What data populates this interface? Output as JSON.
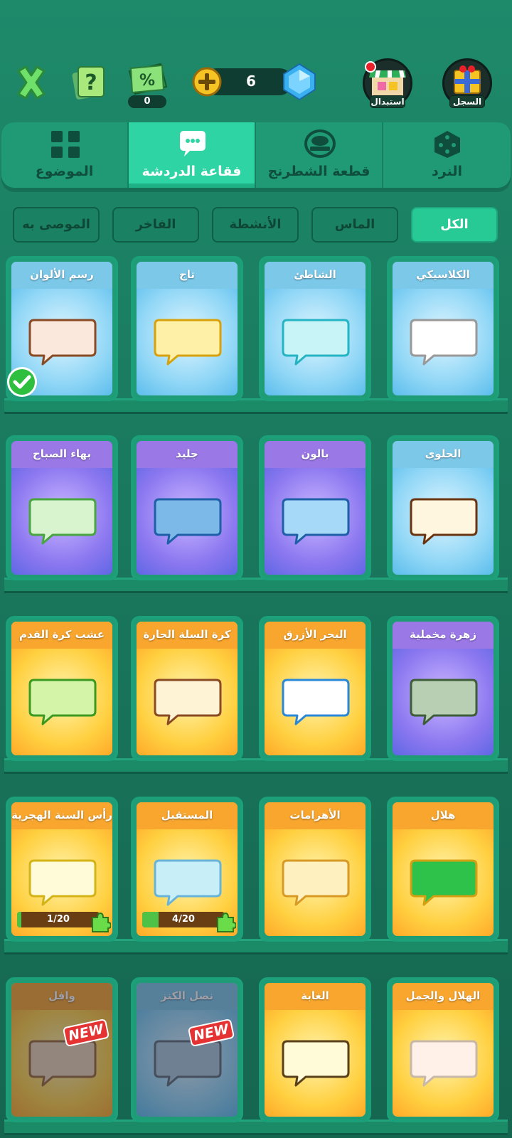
{
  "header": {
    "discount_count": "0",
    "gems": "6",
    "swap_label": "استبدال",
    "history_label": "السجل"
  },
  "tabs": [
    {
      "label": "الموضوع",
      "icon": "grid-icon",
      "active": false
    },
    {
      "label": "فقاعة الدردشة",
      "icon": "chat-bubble-icon",
      "active": true
    },
    {
      "label": "قطعة الشطرنج",
      "icon": "chess-piece-icon",
      "active": false
    },
    {
      "label": "النرد",
      "icon": "dice-icon",
      "active": false
    }
  ],
  "filters": [
    {
      "label": "الموصى به",
      "active": false
    },
    {
      "label": "الفاخر",
      "active": false
    },
    {
      "label": "الأنشطة",
      "active": false
    },
    {
      "label": "الماس",
      "active": false
    },
    {
      "label": "الكل",
      "active": true
    }
  ],
  "items": [
    [
      {
        "title": "رسم الألوان",
        "theme": "blue",
        "bubble": "#fbe8dc",
        "border": "#8a4a23",
        "selected": true
      },
      {
        "title": "تاج",
        "theme": "blue",
        "bubble": "#fff0a8",
        "border": "#d8a20c"
      },
      {
        "title": "الشاطئ",
        "theme": "blue",
        "bubble": "#c8f4f8",
        "border": "#24b4c3"
      },
      {
        "title": "الكلاسيكي",
        "theme": "blue",
        "bubble": "#ffffff",
        "border": "#999999"
      }
    ],
    [
      {
        "title": "بهاء الصباح",
        "theme": "purple",
        "bubble": "#d8f4cf",
        "border": "#48a540"
      },
      {
        "title": "جليد",
        "theme": "purple",
        "bubble": "#7db9e8",
        "border": "#1e5fa8"
      },
      {
        "title": "بالون",
        "theme": "purple",
        "bubble": "#a6d8f8",
        "border": "#1e5fa8"
      },
      {
        "title": "الحلوى",
        "theme": "blue",
        "bubble": "#fff6e0",
        "border": "#6b3410"
      }
    ],
    [
      {
        "title": "عشب كرة القدم",
        "theme": "orange",
        "bubble": "#d4f5a8",
        "border": "#3c9a20"
      },
      {
        "title": "كرة السلة الحارة",
        "theme": "orange",
        "bubble": "#fff3d6",
        "border": "#8a4a23"
      },
      {
        "title": "البحر الأزرق",
        "theme": "orange",
        "bubble": "#ffffff",
        "border": "#2a88d8"
      },
      {
        "title": "زهرة مخملية",
        "theme": "purple",
        "bubble": "#b9cfb4",
        "border": "#3e5e3a"
      }
    ],
    [
      {
        "title": "رأس السنة الهجرية",
        "theme": "orange",
        "bubble": "#fffbd8",
        "border": "#d4b316",
        "progress": "1/20",
        "progress_value": 0.05
      },
      {
        "title": "المستقبل",
        "theme": "orange",
        "bubble": "#c8eef8",
        "border": "#68b4d8",
        "progress": "4/20",
        "progress_value": 0.2
      },
      {
        "title": "الأهرامات",
        "theme": "orange",
        "bubble": "#fff0c0",
        "border": "#d89a26"
      },
      {
        "title": "هلال",
        "theme": "orange",
        "bubble": "#2ec24a",
        "border": "#d4a012"
      }
    ],
    [
      {
        "title": "وافل",
        "theme": "orange",
        "bubble": "#ead3b3",
        "border": "#9a6a38",
        "new": true
      },
      {
        "title": "نصل الكنز",
        "theme": "blue",
        "bubble": "#a8c8d8",
        "border": "#5d6e78",
        "new": true
      },
      {
        "title": "الغابة",
        "theme": "orange",
        "bubble": "#fffbd8",
        "border": "#5a4018"
      },
      {
        "title": "الهلال والجمل",
        "theme": "orange",
        "bubble": "#fff1e8",
        "border": "#c8b8a8"
      }
    ]
  ],
  "new_label": "NEW"
}
